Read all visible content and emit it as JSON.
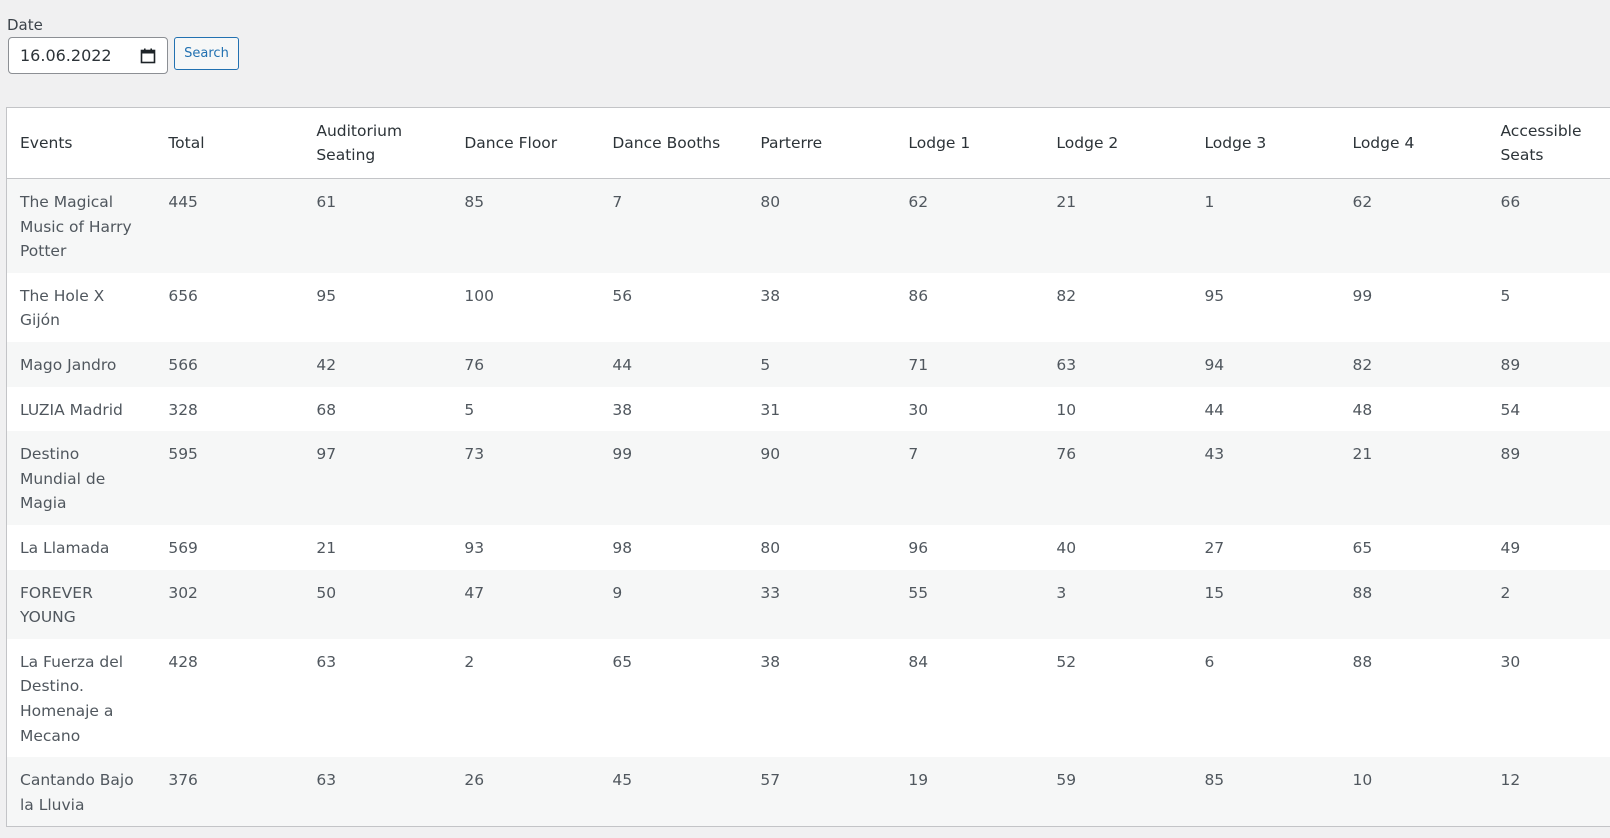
{
  "filter": {
    "date_label": "Date",
    "date_value": "16.06.2022",
    "search_label": "Search"
  },
  "table": {
    "headers": [
      "Events",
      "Total",
      "Auditorium Seating",
      "Dance Floor",
      "Dance Booths",
      "Parterre",
      "Lodge 1",
      "Lodge 2",
      "Lodge 3",
      "Lodge 4",
      "Accessible Seats"
    ],
    "rows": [
      [
        "The Magical Music of Harry Potter",
        "445",
        "61",
        "85",
        "7",
        "80",
        "62",
        "21",
        "1",
        "62",
        "66"
      ],
      [
        "The Hole X Gijón",
        "656",
        "95",
        "100",
        "56",
        "38",
        "86",
        "82",
        "95",
        "99",
        "5"
      ],
      [
        "Mago Jandro",
        "566",
        "42",
        "76",
        "44",
        "5",
        "71",
        "63",
        "94",
        "82",
        "89"
      ],
      [
        "LUZIA Madrid",
        "328",
        "68",
        "5",
        "38",
        "31",
        "30",
        "10",
        "44",
        "48",
        "54"
      ],
      [
        "Destino Mundial de Magia",
        "595",
        "97",
        "73",
        "99",
        "90",
        "7",
        "76",
        "43",
        "21",
        "89"
      ],
      [
        "La Llamada",
        "569",
        "21",
        "93",
        "98",
        "80",
        "96",
        "40",
        "27",
        "65",
        "49"
      ],
      [
        "FOREVER YOUNG",
        "302",
        "50",
        "47",
        "9",
        "33",
        "55",
        "3",
        "15",
        "88",
        "2"
      ],
      [
        "La Fuerza del Destino. Homenaje a Mecano",
        "428",
        "63",
        "2",
        "65",
        "38",
        "84",
        "52",
        "6",
        "88",
        "30"
      ],
      [
        "Cantando Bajo la Lluvia",
        "376",
        "63",
        "26",
        "45",
        "57",
        "19",
        "59",
        "85",
        "10",
        "12"
      ]
    ]
  }
}
